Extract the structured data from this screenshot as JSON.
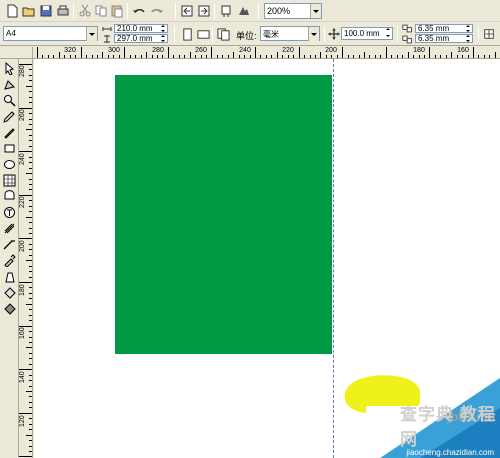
{
  "toolbar": {
    "zoom_value": "200%",
    "icons": [
      "new-icon",
      "open-icon",
      "save-icon",
      "print-icon",
      "cut-icon",
      "copy-icon",
      "paste-icon",
      "undo-icon",
      "redo-icon",
      "import-icon",
      "export-icon",
      "app-launcher-icon",
      "welcome-icon"
    ]
  },
  "propbar": {
    "page_size": "A4",
    "width": "210.0 mm",
    "height": "297.0 mm",
    "units_label": "单位:",
    "units_value": "毫米",
    "nudge": "100.0 mm",
    "dup_x": "6.35 mm",
    "dup_y": "6.35 mm"
  },
  "hruler": {
    "labels": [
      "320",
      "300",
      "280",
      "260",
      "240",
      "220",
      "200",
      "180",
      "160"
    ]
  },
  "vruler": {
    "labels": [
      "280",
      "260",
      "240",
      "220",
      "200",
      "180",
      "160",
      "140",
      "120"
    ]
  },
  "canvas": {
    "rect_color": "#009a44",
    "ellipse_color": "#eef21a"
  },
  "watermark": {
    "site": "jb51.net",
    "text": "查字典 教程网",
    "url": "jiaocheng.chazidian.com"
  }
}
